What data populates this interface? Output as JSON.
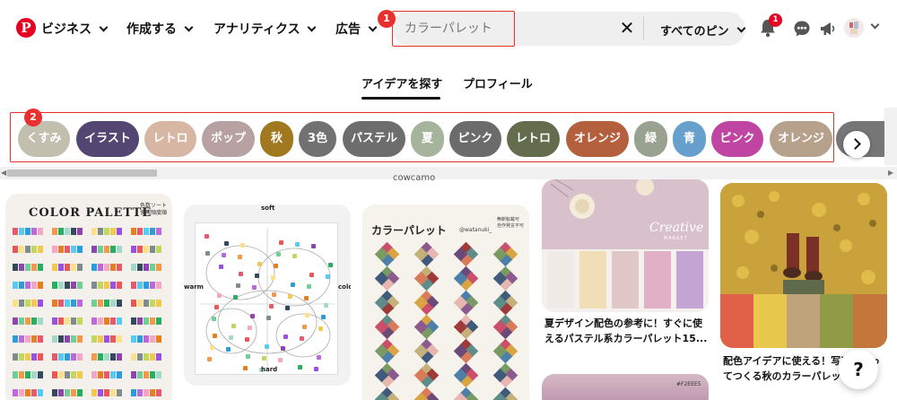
{
  "header": {
    "logo": "P",
    "nav": {
      "business": "ビジネス",
      "create": "作成する",
      "analytics": "アナリティクス",
      "ads": "広告"
    },
    "search": {
      "value": "カラーパレット",
      "clear": "✕",
      "scope": "すべてのピン"
    },
    "notif_count": "1",
    "annotation_markers": [
      "1",
      "2"
    ]
  },
  "tabs": {
    "explore": "アイデアを探す",
    "profile": "プロフィール"
  },
  "chips": [
    {
      "label": "くすみ",
      "color": "#c3bfae"
    },
    {
      "label": "イラスト",
      "color": "#534672"
    },
    {
      "label": "レトロ",
      "color": "#d7b6a4"
    },
    {
      "label": "ポップ",
      "color": "#b7a1a3"
    },
    {
      "label": "秋",
      "color": "#a0781f"
    },
    {
      "label": "3色",
      "color": "#717171"
    },
    {
      "label": "パステル",
      "color": "#6d6d6d"
    },
    {
      "label": "夏",
      "color": "#a7b49c"
    },
    {
      "label": "ピンク",
      "color": "#6b6b6b"
    },
    {
      "label": "レトロ",
      "color": "#636c4c"
    },
    {
      "label": "オレンジ",
      "color": "#b4603f"
    },
    {
      "label": "緑",
      "color": "#99a190"
    },
    {
      "label": "青",
      "color": "#67a0cc"
    },
    {
      "label": "ピンク",
      "color": "#c045a2"
    },
    {
      "label": "オレンジ",
      "color": "#b6a18d"
    }
  ],
  "pins": {
    "cowcamo": "cowcamo",
    "color_palette_doc": {
      "title": "COLOR PALETTE",
      "subtitle": "色数ソート\n使用頻度順"
    },
    "wheel": {
      "soft": "soft",
      "hard": "hard",
      "warm": "warm",
      "cold": "cold"
    },
    "diamond_doc": {
      "title": "カラーパレット",
      "handle": "@watanuki_",
      "note": "無断転載可\n自作発言不可"
    },
    "pastel": {
      "brand": "Creative",
      "brand_sub": "MARKET",
      "title": "夏デザイン配色の参考に！すぐに使えるパステル系カラーパレット15..."
    },
    "autumn": {
      "title": "配色アイデアに使える！写真で作ってつくる秋のカラーパレッ..."
    },
    "bottom_hex": "#F2EEE5"
  },
  "help": "?"
}
